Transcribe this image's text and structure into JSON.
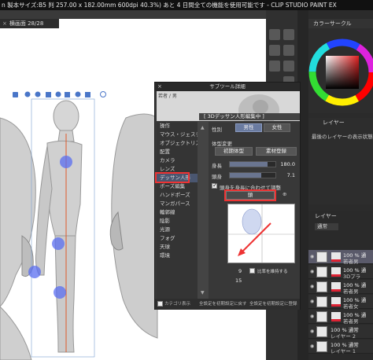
{
  "titlebar": {
    "text": "n 製本サイズ:B5 判 257.00 x 182.00mm 600dpi 40.3%) あと 4 日間全ての機能を使用可能です - CLIP STUDIO PAINT EX"
  },
  "canvas": {
    "tab_close": "×",
    "tab_label": "横画面 28/28"
  },
  "color_panel": {
    "title": "カラーサークル"
  },
  "layer_property": {
    "tab": "レイヤー",
    "text": "最後のレイヤーの表示状態"
  },
  "layer_panel": {
    "tab": "レイヤー",
    "blend": "通常",
    "rows": [
      {
        "line1": "100 % 通",
        "line2": "若者男",
        "selected": true
      },
      {
        "line1": "100 % 通",
        "line2": "3Dプラ",
        "selected": false
      },
      {
        "line1": "100 % 通",
        "line2": "若者男",
        "selected": false
      },
      {
        "line1": "100 % 通",
        "line2": "若者女",
        "selected": false
      },
      {
        "line1": "100 % 通",
        "line2": "若者男",
        "selected": false
      },
      {
        "line1": "100 % 通常",
        "line2": "レイヤー 2",
        "selected": false
      },
      {
        "line1": "100 % 通常",
        "line2": "レイヤー 1",
        "selected": false
      }
    ]
  },
  "dialog": {
    "title": "サブツール詳細",
    "close": "×",
    "preview_label": "若者 / 男",
    "category_header": "[ 3Dデッサン人形編集中 ]",
    "categories": [
      "操作",
      "マウス・ジェスチャー",
      "オブジェクトリスト",
      "配置",
      "カメラ",
      "レンズ",
      "デッサン人形",
      "ポーズ編集",
      "ハンドポーズ",
      "マンガパース",
      "輪郭線",
      "陰影",
      "光源",
      "フォグ",
      "天球",
      "環境"
    ],
    "selected_category": "デッサン人形",
    "gender_label": "性別",
    "male": "男性",
    "female": "女性",
    "body_change_label": "体型変更",
    "initial_body": "初期体型",
    "register_material": "素材登録",
    "height_label": "身長",
    "height_value": "180.0",
    "head_label": "頭身",
    "head_value": "7.1",
    "check_label": "頭身を身長に合わせて調整",
    "dropdown_value": "頭",
    "step1_value": "9",
    "step1_label": "比率を維持する",
    "step2_value": "15",
    "category_toggle": "カテゴリ表示",
    "reset_all": "全設定を初期設定に戻す",
    "register_all": "全設定を初期設定に登録"
  }
}
